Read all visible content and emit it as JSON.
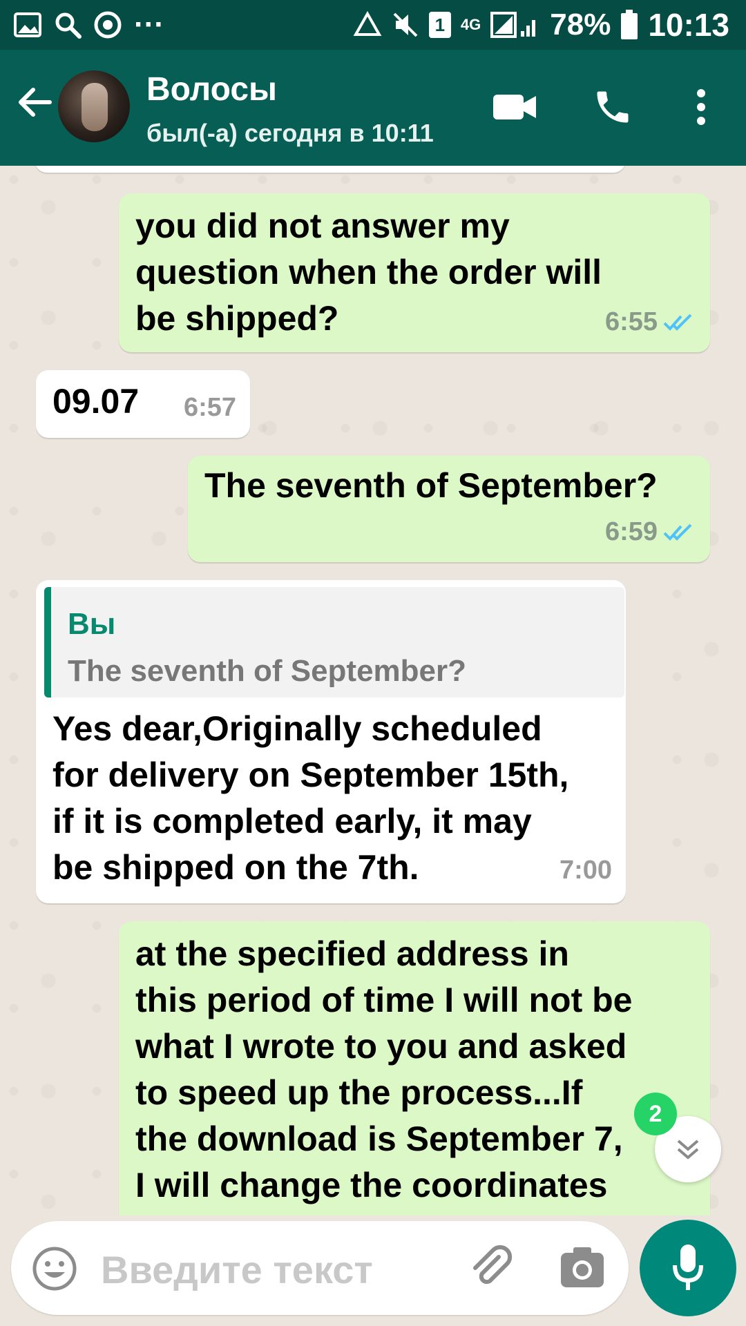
{
  "status_bar": {
    "battery": "78%",
    "time": "10:13",
    "network": "4G",
    "sim": "1",
    "dots": "···"
  },
  "header": {
    "name": "Волосы",
    "last_seen": "был(-а) сегодня в 10:11"
  },
  "messages": [
    {
      "dir": "out",
      "text": "you did not answer my\nquestion when the order will\nbe shipped?",
      "time": "6:55",
      "status": "read"
    },
    {
      "dir": "in",
      "text": "09.07",
      "time": "6:57"
    },
    {
      "dir": "out",
      "text": "The seventh of September?",
      "time": "6:59",
      "status": "read"
    },
    {
      "dir": "in",
      "reply_to": {
        "name": "Вы",
        "text": "The seventh of September?"
      },
      "text": "Yes dear,Originally scheduled\nfor delivery on September 15th,\nif it is completed early, it may\nbe shipped on the 7th.",
      "time": "7:00"
    },
    {
      "dir": "out",
      "text": "at the specified address in\nthis period of time I will not be\nwhat I wrote to you and asked\nto speed up the process...If\nthe download is September 7,\nI will change the coordinates"
    }
  ],
  "unread_count": "2",
  "input": {
    "placeholder": "Введите текст"
  },
  "colors": {
    "header": "#075e54",
    "status_bar": "#054d44",
    "outgoing_bubble": "#dcf8c6",
    "incoming_bubble": "#ffffff",
    "accent": "#00897b",
    "read_ticks": "#4fc3f7"
  },
  "icons": [
    "back-arrow-icon",
    "video-call-icon",
    "phone-icon",
    "more-vert-icon",
    "emoji-icon",
    "attach-icon",
    "camera-icon",
    "mic-icon",
    "chevron-down-icon",
    "double-check-icon"
  ]
}
